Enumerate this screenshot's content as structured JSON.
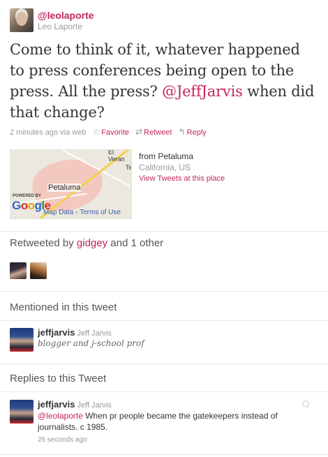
{
  "author": {
    "screen_name": "@leolaporte",
    "real_name": "Leo Laporte"
  },
  "tweet": {
    "text_before": "Come to think of it, whatever happened to press conferences being open to the press. All the press? ",
    "mention": "@JeffJarvis",
    "text_after": " when did that change?",
    "time": "2 minutes ago",
    "via": "via web",
    "favorite": "Favorite",
    "retweet": "Retweet",
    "reply": "Reply"
  },
  "map": {
    "city_label": "Petaluma",
    "top_label": "El Veran",
    "side_label": "Te",
    "powered_by": "POWERED BY",
    "google": [
      "G",
      "o",
      "o",
      "g",
      "l",
      "e"
    ],
    "map_data": "Map Data",
    "separator": "-",
    "terms": "Terms of Use"
  },
  "place": {
    "from": "from Petaluma",
    "region": "California, US",
    "view": "View Tweets at this place"
  },
  "retweeted": {
    "prefix": "Retweeted by",
    "user": "gidgey",
    "suffix": "and 1 other"
  },
  "mentioned": {
    "title": "Mentioned in this tweet",
    "screen_name": "jeffjarvis",
    "real_name": "Jeff Jarvis",
    "bio": "blogger and j-school prof"
  },
  "replies": {
    "title": "Replies to this Tweet",
    "screen_name": "jeffjarvis",
    "real_name": "Jeff Jarvis",
    "mention": "@leolaporte",
    "text": " When pr people became the gatekeepers instead of journalists. c 1985.",
    "time": "26 seconds ago"
  },
  "icons": {
    "favorite": "star-icon",
    "retweet": "retweet-icon",
    "reply": "reply-arrow-icon",
    "reply_action": "reply-speech-icon"
  },
  "colors": {
    "accent": "#c1275f",
    "muted": "#999999",
    "text": "#333333"
  }
}
